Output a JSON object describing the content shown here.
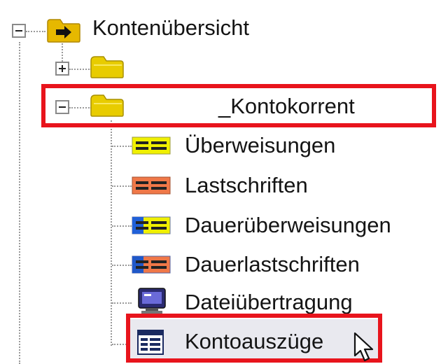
{
  "tree": {
    "root": {
      "label": "Kontenübersicht",
      "expander": "−",
      "icon": "folder-arrow-icon"
    },
    "collapsed_account": {
      "label": "",
      "expander": "+",
      "icon": "folder-icon"
    },
    "expanded_account": {
      "label": "_Kontokorrent",
      "expander": "−",
      "icon": "folder-icon"
    },
    "children": [
      {
        "label": "Überweisungen",
        "icon": "transfer-icon"
      },
      {
        "label": "Lastschriften",
        "icon": "direct-debit-icon"
      },
      {
        "label": "Dauerüberweisungen",
        "icon": "standing-order-icon"
      },
      {
        "label": "Dauerlastschriften",
        "icon": "recurring-debit-icon"
      },
      {
        "label": "Dateiübertragung",
        "icon": "file-transfer-icon"
      },
      {
        "label": "Kontoauszüge",
        "icon": "account-statement-icon"
      }
    ]
  },
  "colors": {
    "highlight": "#e8141c",
    "folder": "#e6c800",
    "transfer": "#f0f000",
    "debit": "#f07848",
    "standing_order_stripe": "#2060d8",
    "recurring_debit_stripe": "#2058c8"
  }
}
